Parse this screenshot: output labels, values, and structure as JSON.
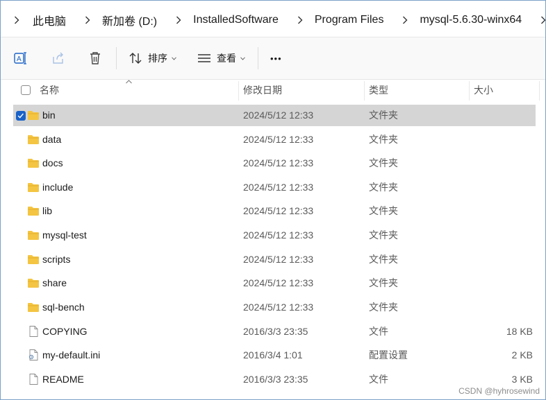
{
  "breadcrumb": [
    "此电脑",
    "新加卷 (D:)",
    "InstalledSoftware",
    "Program Files",
    "mysql-5.6.30-winx64"
  ],
  "toolbar": {
    "sort_label": "排序",
    "view_label": "查看",
    "more_label": "•••"
  },
  "columns": {
    "name": "名称",
    "date": "修改日期",
    "type": "类型",
    "size": "大小"
  },
  "files": [
    {
      "name": "bin",
      "date": "2024/5/12 12:33",
      "type": "文件夹",
      "size": "",
      "icon": "folder-icon",
      "selected": true
    },
    {
      "name": "data",
      "date": "2024/5/12 12:33",
      "type": "文件夹",
      "size": "",
      "icon": "folder-icon",
      "selected": false
    },
    {
      "name": "docs",
      "date": "2024/5/12 12:33",
      "type": "文件夹",
      "size": "",
      "icon": "folder-icon",
      "selected": false
    },
    {
      "name": "include",
      "date": "2024/5/12 12:33",
      "type": "文件夹",
      "size": "",
      "icon": "folder-icon",
      "selected": false
    },
    {
      "name": "lib",
      "date": "2024/5/12 12:33",
      "type": "文件夹",
      "size": "",
      "icon": "folder-icon",
      "selected": false
    },
    {
      "name": "mysql-test",
      "date": "2024/5/12 12:33",
      "type": "文件夹",
      "size": "",
      "icon": "folder-icon",
      "selected": false
    },
    {
      "name": "scripts",
      "date": "2024/5/12 12:33",
      "type": "文件夹",
      "size": "",
      "icon": "folder-icon",
      "selected": false
    },
    {
      "name": "share",
      "date": "2024/5/12 12:33",
      "type": "文件夹",
      "size": "",
      "icon": "folder-icon",
      "selected": false
    },
    {
      "name": "sql-bench",
      "date": "2024/5/12 12:33",
      "type": "文件夹",
      "size": "",
      "icon": "folder-icon",
      "selected": false
    },
    {
      "name": "COPYING",
      "date": "2016/3/3 23:35",
      "type": "文件",
      "size": "18 KB",
      "icon": "file-icon",
      "selected": false
    },
    {
      "name": "my-default.ini",
      "date": "2016/3/4 1:01",
      "type": "配置设置",
      "size": "2 KB",
      "icon": "settings-file-icon",
      "selected": false
    },
    {
      "name": "README",
      "date": "2016/3/3 23:35",
      "type": "文件",
      "size": "3 KB",
      "icon": "file-icon",
      "selected": false
    }
  ],
  "watermark": "CSDN @hyhrosewind",
  "colors": {
    "accent": "#1a62c8",
    "selection": "#d5d5d5",
    "folder": "#f4c542"
  }
}
